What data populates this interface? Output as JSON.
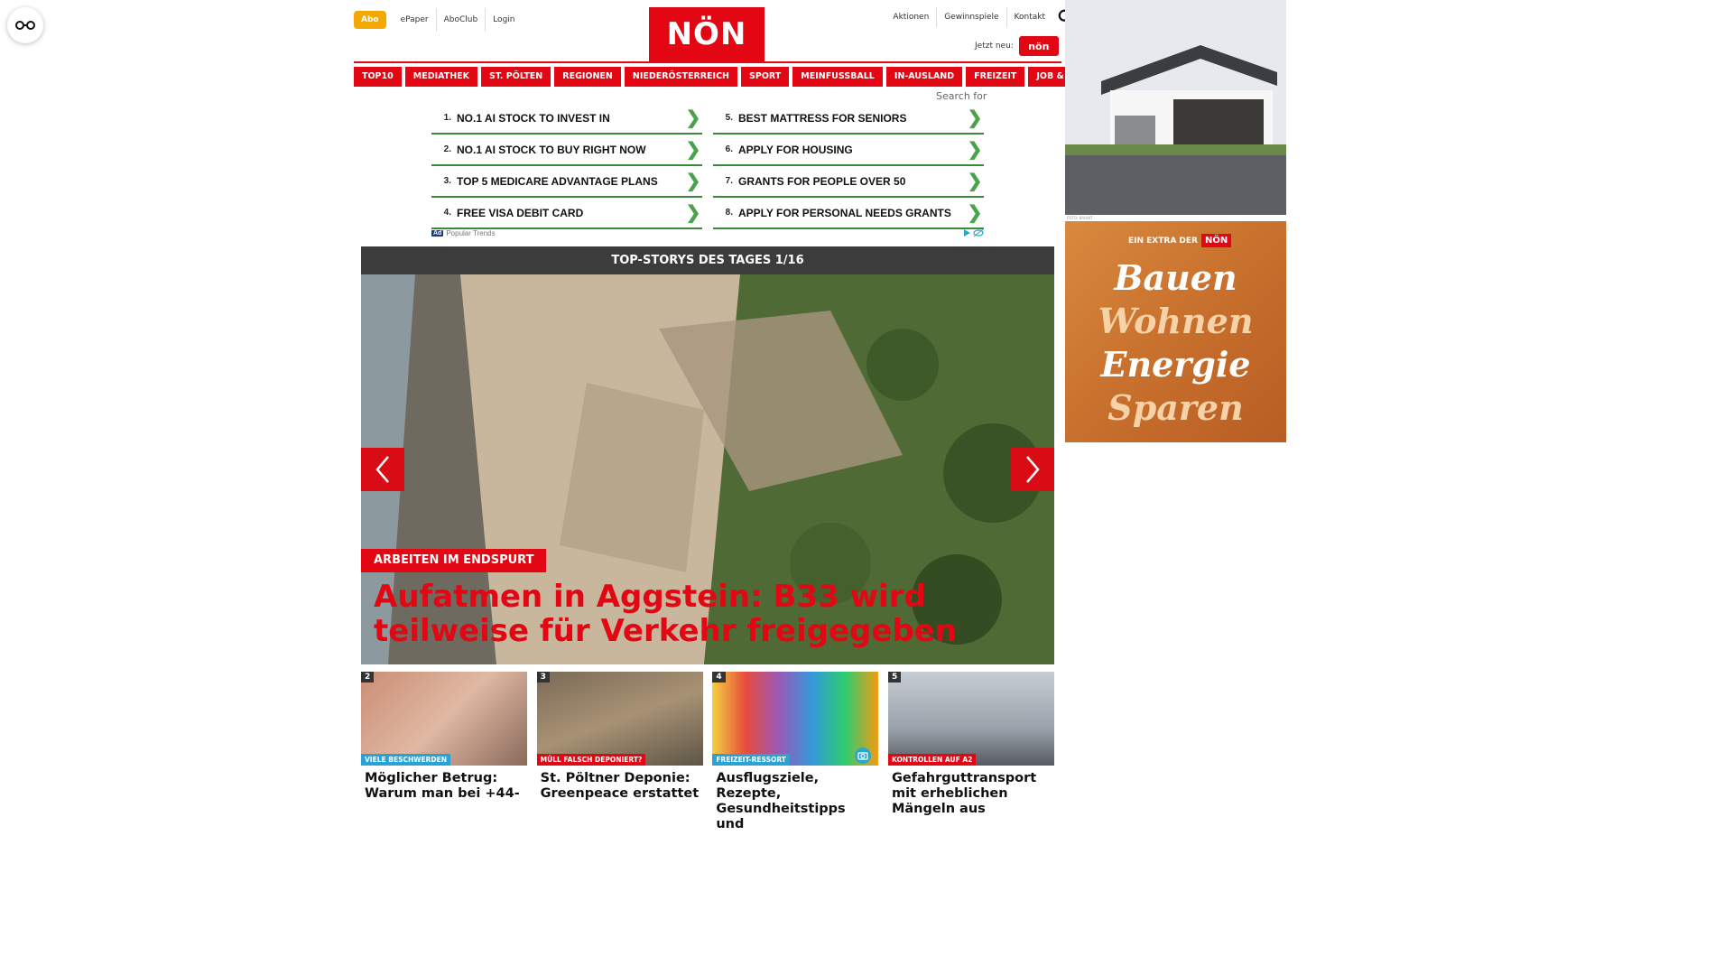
{
  "accessibility": {
    "icon": "glasses-icon"
  },
  "topbar": {
    "abo_label": "Abo",
    "left_links": [
      "ePaper",
      "AboClub",
      "Login"
    ],
    "right_links": [
      "Aktionen",
      "Gewinnspiele",
      "Kontakt"
    ],
    "search_icon": "search-icon",
    "jetzt_label": "Jetzt neu:",
    "jetzt_badge": "nön"
  },
  "logo": {
    "text": "NÖN",
    "color": "#e30613"
  },
  "nav": {
    "items": [
      "TOP10",
      "MEDIATHEK",
      "ST. PÖLTEN",
      "REGIONEN",
      "NIEDERÖSTERREICH",
      "SPORT",
      "MEINFUSSBALL",
      "IN-AUSLAND",
      "FREIZEIT",
      "JOB & KARRIERE"
    ]
  },
  "ad_search": {
    "label": "Search for",
    "left": [
      {
        "num": "1.",
        "text": "NO.1 AI STOCK TO INVEST IN"
      },
      {
        "num": "2.",
        "text": "NO.1 AI STOCK TO BUY RIGHT NOW"
      },
      {
        "num": "3.",
        "text": "TOP 5 MEDICARE ADVANTAGE PLANS"
      },
      {
        "num": "4.",
        "text": "FREE VISA DEBIT CARD"
      }
    ],
    "right": [
      {
        "num": "5.",
        "text": "BEST MATTRESS FOR SENIORS"
      },
      {
        "num": "6.",
        "text": "APPLY FOR HOUSING"
      },
      {
        "num": "7.",
        "text": "GRANTS FOR PEOPLE OVER 50"
      },
      {
        "num": "8.",
        "text": "APPLY FOR PERSONAL NEEDS GRANTS"
      }
    ],
    "ad_badge": "Ad",
    "footer": "Popular Trends",
    "chevron": "❯",
    "accent": "#3a8a3a"
  },
  "topstories": {
    "header": "TOP-STORYS DES TAGES 1/16",
    "hero_kicker": "ARBEITEN IM ENDSPURT",
    "hero_title": "Aufatmen in Aggstein: B33 wird teilweise für Verkehr freigegeben",
    "prev_icon": "chevron-left-icon",
    "next_icon": "chevron-right-icon"
  },
  "cards": [
    {
      "num": "2",
      "kicker": "VIELE BESCHWERDEN",
      "kicker_color": "#29a3d6",
      "title": "Möglicher Betrug: Warum man bei +44-"
    },
    {
      "num": "3",
      "kicker": "MÜLL FALSCH DEPONIERT?",
      "kicker_color": "#e30613",
      "title": "St. Pöltner Deponie: Greenpeace erstattet"
    },
    {
      "num": "4",
      "kicker": "FREIZEIT-RESSORT",
      "kicker_color": "#29a3d6",
      "title": "Ausflugsziele, Rezepte, Gesundheitstipps und"
    },
    {
      "num": "5",
      "kicker": "KONTROLLEN AUF A2",
      "kicker_color": "#e30613",
      "title": "Gefahrguttransport mit erheblichen Mängeln aus"
    }
  ],
  "side_ads": {
    "credit": "FOTO: BAUHIT",
    "extra_text": "EIN EXTRA DER",
    "extra_logo": "NÖN",
    "words": [
      "Bauen",
      "Wohnen",
      "Energie",
      "Sparen"
    ]
  }
}
